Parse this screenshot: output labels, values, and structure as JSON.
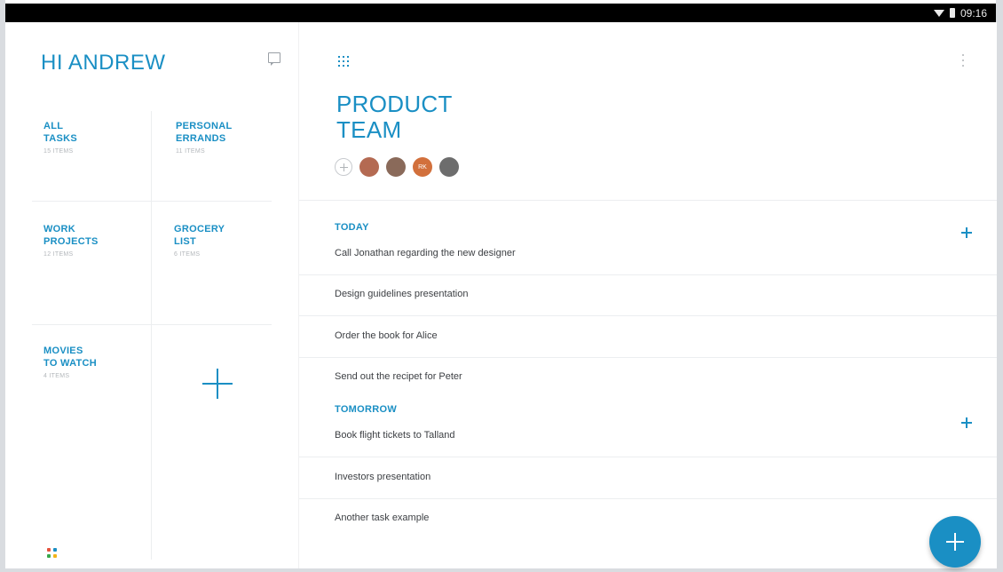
{
  "status_bar": {
    "time": "09:16",
    "icons": [
      "wifi-icon",
      "battery-icon"
    ]
  },
  "drawer": {
    "greeting": "HI ANDREW",
    "icons": [
      "chat-icon",
      "add-list-icon",
      "app-dots-icon"
    ],
    "lists": [
      {
        "title_line1": "ALL",
        "title_line2": "TASKS",
        "count": "15 ITEMS"
      },
      {
        "title_line1": "PERSONAL",
        "title_line2": "ERRANDS",
        "count": "11 ITEMS"
      },
      {
        "title_line1": "WORK",
        "title_line2": "PROJECTS",
        "count": "12 ITEMS"
      },
      {
        "title_line1": "GROCERY",
        "title_line2": "LIST",
        "count": "6 ITEMS"
      },
      {
        "title_line1": "MOVIES",
        "title_line2": "TO WATCH",
        "count": "4 ITEMS"
      }
    ]
  },
  "main": {
    "title_line1": "PRODUCT",
    "title_line2": "TEAM",
    "members": [
      {
        "initials": "",
        "color": "#b46a52"
      },
      {
        "initials": "",
        "color": "#8a6a5a"
      },
      {
        "initials": "RK",
        "color": "#d2703c"
      },
      {
        "initials": "",
        "color": "#6d6d6d"
      }
    ],
    "sections": [
      {
        "title": "TODAY",
        "tasks": [
          "Call Jonathan regarding the new designer",
          "Design guidelines presentation",
          "Order the book for Alice",
          "Send out the recipet for Peter"
        ]
      },
      {
        "title": "TOMORROW",
        "tasks": [
          "Book flight tickets to Talland",
          "Investors presentation",
          "Another task example"
        ]
      }
    ]
  },
  "colors": {
    "accent": "#1a8fc4",
    "text": "#3c3f43",
    "muted": "#b3b7bb",
    "divider": "#eceef0"
  }
}
